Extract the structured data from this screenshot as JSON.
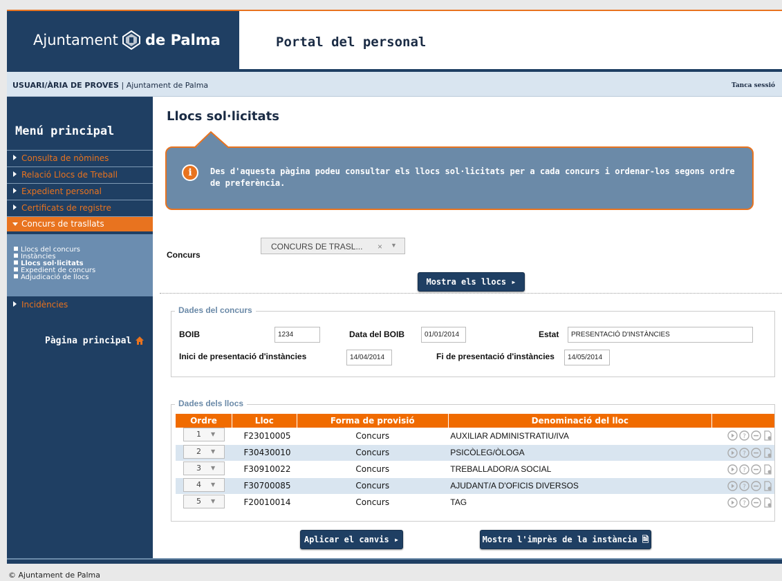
{
  "header": {
    "logo_part1": "Ajuntament",
    "logo_part2": "de Palma",
    "portal_title": "Portal del personal"
  },
  "userbar": {
    "user": "USUARI/ÀRIA DE PROVES",
    "separator": " | ",
    "org": "Ajuntament de Palma",
    "logout": "Tanca sessió"
  },
  "sidebar": {
    "title": "Menú principal",
    "items": [
      {
        "label": "Consulta de nòmines"
      },
      {
        "label": "Relació Llocs de Treball"
      },
      {
        "label": "Expedient personal"
      },
      {
        "label": "Certificats de registre"
      },
      {
        "label": "Concurs de trasllats"
      }
    ],
    "subitems": [
      {
        "label": "Llocs del concurs"
      },
      {
        "label": "Instàncies"
      },
      {
        "label": "Llocs sol·licitats"
      },
      {
        "label": "Expedient de concurs"
      },
      {
        "label": "Adjudicació de llocs"
      }
    ],
    "incidencies": "Incidències",
    "home": "Pàgina principal",
    "home_icon": "home-icon"
  },
  "main": {
    "page_title": "Llocs sol·licitats",
    "info_text": "Des d'aquesta pàgina podeu consultar els llocs sol·licitats per a cada concurs i ordenar-los segons ordre de preferència.",
    "info_icon": "info-icon",
    "concurs_label": "Concurs",
    "concurs_value": "CONCURS DE TRASL...",
    "concurs_clear": "×",
    "concurs_arrow": "▼",
    "show_button": "Mostra els llocs",
    "dades_concurs": {
      "legend": "Dades del concurs",
      "boib_label": "BOIB",
      "boib_value": "1234",
      "data_boib_label": "Data del BOIB",
      "data_boib_value": "01/01/2014",
      "estat_label": "Estat",
      "estat_value": "PRESENTACIÓ D'INSTÀNCIES",
      "inici_label": "Inici de presentació d'instàncies",
      "inici_value": "14/04/2014",
      "fi_label": "Fi de presentació d'instàncies",
      "fi_value": "14/05/2014"
    },
    "dades_llocs": {
      "legend": "Dades dels llocs",
      "columns": [
        "Ordre",
        "Lloc",
        "Forma de provisió",
        "Denominació del lloc",
        ""
      ],
      "rows": [
        {
          "ordre": "1",
          "lloc": "F23010005",
          "forma": "Concurs",
          "denominacio": "AUXILIAR ADMINISTRATIU/IVA"
        },
        {
          "ordre": "2",
          "lloc": "F30430010",
          "forma": "Concurs",
          "denominacio": "PSICÒLEG/ÒLOGA"
        },
        {
          "ordre": "3",
          "lloc": "F30910022",
          "forma": "Concurs",
          "denominacio": "TREBALLADOR/A SOCIAL"
        },
        {
          "ordre": "4",
          "lloc": "F30700085",
          "forma": "Concurs",
          "denominacio": "AJUDANT/A D'OFICIS DIVERSOS"
        },
        {
          "ordre": "5",
          "lloc": "F20010014",
          "forma": "Concurs",
          "denominacio": "TAG"
        }
      ],
      "row_actions": [
        "play-icon",
        "help-icon",
        "remove-icon",
        "document-icon"
      ]
    },
    "apply_button": "Aplicar el canvis",
    "print_button": "Mostra l'imprès de la instància"
  },
  "footer": {
    "copyright": "© Ajuntament de Palma"
  },
  "colors": {
    "navy": "#1f3f63",
    "orange": "#e8731f",
    "steel": "#6b8aa8",
    "light_blue": "#d9e5f0"
  }
}
